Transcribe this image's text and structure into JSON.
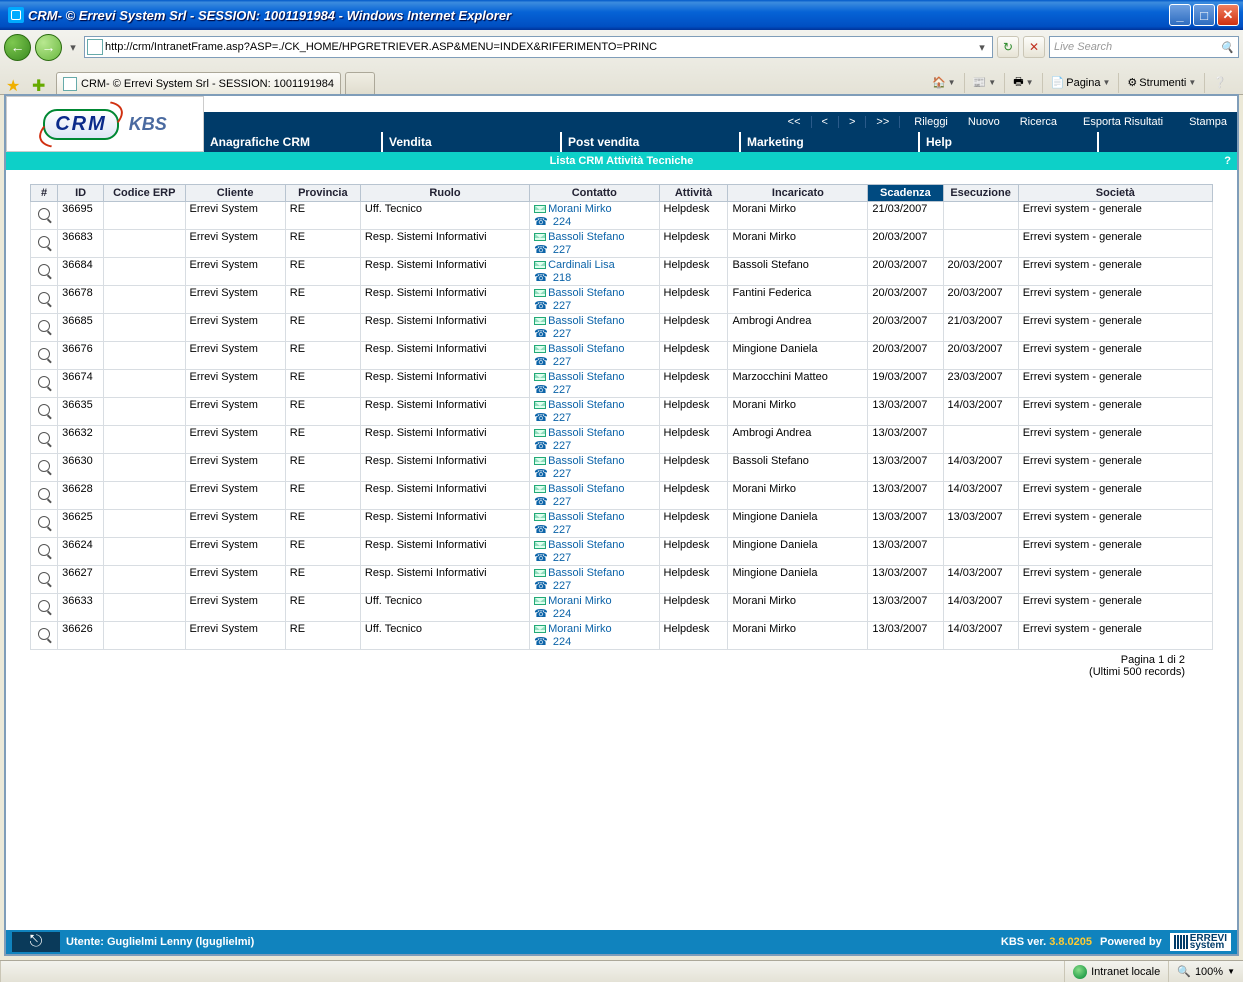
{
  "window": {
    "title": "CRM- © Errevi System Srl - SESSION: 1001191984 - Windows Internet Explorer"
  },
  "browser": {
    "url": "http://crm/IntranetFrame.asp?ASP=./CK_HOME/HPGRETRIEVER.ASP&MENU=INDEX&RIFERIMENTO=PRINC",
    "search_placeholder": "Live Search",
    "tab_title": "CRM- © Errevi System Srl - SESSION: 1001191984",
    "page_menu": "Pagina",
    "tools_menu": "Strumenti"
  },
  "crm": {
    "logo": "CRM",
    "kbs": "KBS",
    "nav": {
      "first": "<<",
      "prev": "<",
      "next": ">",
      "last": ">>"
    },
    "actions": {
      "rileggi": "Rileggi",
      "nuovo": "Nuovo",
      "ricerca": "Ricerca",
      "esporta": "Esporta Risultati",
      "stampa": "Stampa"
    },
    "menu": {
      "anagrafiche": "Anagrafiche CRM",
      "vendita": "Vendita",
      "postvendita": "Post vendita",
      "marketing": "Marketing",
      "help": "Help"
    },
    "list_title": "Lista CRM Attività Tecniche",
    "help_q": "?"
  },
  "table": {
    "headers": {
      "num": "#",
      "id": "ID",
      "erp": "Codice ERP",
      "cliente": "Cliente",
      "provincia": "Provincia",
      "ruolo": "Ruolo",
      "contatto": "Contatto",
      "attivita": "Attività",
      "incaricato": "Incaricato",
      "scadenza": "Scadenza",
      "esecuzione": "Esecuzione",
      "societa": "Società"
    },
    "rows": [
      {
        "id": "36695",
        "cliente": "Errevi System",
        "prov": "RE",
        "ruolo": "Uff. Tecnico",
        "contatto": "Morani Mirko",
        "ext": "224",
        "att": "Helpdesk",
        "inc": "Morani Mirko",
        "sca": "21/03/2007",
        "ese": "",
        "soc": "Errevi system - generale"
      },
      {
        "id": "36683",
        "cliente": "Errevi System",
        "prov": "RE",
        "ruolo": "Resp. Sistemi Informativi",
        "contatto": "Bassoli Stefano",
        "ext": "227",
        "att": "Helpdesk",
        "inc": "Morani Mirko",
        "sca": "20/03/2007",
        "ese": "",
        "soc": "Errevi system - generale"
      },
      {
        "id": "36684",
        "cliente": "Errevi System",
        "prov": "RE",
        "ruolo": "Resp. Sistemi Informativi",
        "contatto": "Cardinali Lisa",
        "ext": "218",
        "att": "Helpdesk",
        "inc": "Bassoli Stefano",
        "sca": "20/03/2007",
        "ese": "20/03/2007",
        "soc": "Errevi system - generale"
      },
      {
        "id": "36678",
        "cliente": "Errevi System",
        "prov": "RE",
        "ruolo": "Resp. Sistemi Informativi",
        "contatto": "Bassoli Stefano",
        "ext": "227",
        "att": "Helpdesk",
        "inc": "Fantini Federica",
        "sca": "20/03/2007",
        "ese": "20/03/2007",
        "soc": "Errevi system - generale"
      },
      {
        "id": "36685",
        "cliente": "Errevi System",
        "prov": "RE",
        "ruolo": "Resp. Sistemi Informativi",
        "contatto": "Bassoli Stefano",
        "ext": "227",
        "att": "Helpdesk",
        "inc": "Ambrogi Andrea",
        "sca": "20/03/2007",
        "ese": "21/03/2007",
        "soc": "Errevi system - generale"
      },
      {
        "id": "36676",
        "cliente": "Errevi System",
        "prov": "RE",
        "ruolo": "Resp. Sistemi Informativi",
        "contatto": "Bassoli Stefano",
        "ext": "227",
        "att": "Helpdesk",
        "inc": "Mingione Daniela",
        "sca": "20/03/2007",
        "ese": "20/03/2007",
        "soc": "Errevi system - generale"
      },
      {
        "id": "36674",
        "cliente": "Errevi System",
        "prov": "RE",
        "ruolo": "Resp. Sistemi Informativi",
        "contatto": "Bassoli Stefano",
        "ext": "227",
        "att": "Helpdesk",
        "inc": "Marzocchini Matteo",
        "sca": "19/03/2007",
        "ese": "23/03/2007",
        "soc": "Errevi system - generale"
      },
      {
        "id": "36635",
        "cliente": "Errevi System",
        "prov": "RE",
        "ruolo": "Resp. Sistemi Informativi",
        "contatto": "Bassoli Stefano",
        "ext": "227",
        "att": "Helpdesk",
        "inc": "Morani Mirko",
        "sca": "13/03/2007",
        "ese": "14/03/2007",
        "soc": "Errevi system - generale"
      },
      {
        "id": "36632",
        "cliente": "Errevi System",
        "prov": "RE",
        "ruolo": "Resp. Sistemi Informativi",
        "contatto": "Bassoli Stefano",
        "ext": "227",
        "att": "Helpdesk",
        "inc": "Ambrogi Andrea",
        "sca": "13/03/2007",
        "ese": "",
        "soc": "Errevi system - generale"
      },
      {
        "id": "36630",
        "cliente": "Errevi System",
        "prov": "RE",
        "ruolo": "Resp. Sistemi Informativi",
        "contatto": "Bassoli Stefano",
        "ext": "227",
        "att": "Helpdesk",
        "inc": "Bassoli Stefano",
        "sca": "13/03/2007",
        "ese": "14/03/2007",
        "soc": "Errevi system - generale"
      },
      {
        "id": "36628",
        "cliente": "Errevi System",
        "prov": "RE",
        "ruolo": "Resp. Sistemi Informativi",
        "contatto": "Bassoli Stefano",
        "ext": "227",
        "att": "Helpdesk",
        "inc": "Morani Mirko",
        "sca": "13/03/2007",
        "ese": "14/03/2007",
        "soc": "Errevi system - generale"
      },
      {
        "id": "36625",
        "cliente": "Errevi System",
        "prov": "RE",
        "ruolo": "Resp. Sistemi Informativi",
        "contatto": "Bassoli Stefano",
        "ext": "227",
        "att": "Helpdesk",
        "inc": "Mingione Daniela",
        "sca": "13/03/2007",
        "ese": "13/03/2007",
        "soc": "Errevi system - generale"
      },
      {
        "id": "36624",
        "cliente": "Errevi System",
        "prov": "RE",
        "ruolo": "Resp. Sistemi Informativi",
        "contatto": "Bassoli Stefano",
        "ext": "227",
        "att": "Helpdesk",
        "inc": "Mingione Daniela",
        "sca": "13/03/2007",
        "ese": "",
        "soc": "Errevi system - generale"
      },
      {
        "id": "36627",
        "cliente": "Errevi System",
        "prov": "RE",
        "ruolo": "Resp. Sistemi Informativi",
        "contatto": "Bassoli Stefano",
        "ext": "227",
        "att": "Helpdesk",
        "inc": "Mingione Daniela",
        "sca": "13/03/2007",
        "ese": "14/03/2007",
        "soc": "Errevi system - generale"
      },
      {
        "id": "36633",
        "cliente": "Errevi System",
        "prov": "RE",
        "ruolo": "Uff. Tecnico",
        "contatto": "Morani Mirko",
        "ext": "224",
        "att": "Helpdesk",
        "inc": "Morani Mirko",
        "sca": "13/03/2007",
        "ese": "14/03/2007",
        "soc": "Errevi system - generale"
      },
      {
        "id": "36626",
        "cliente": "Errevi System",
        "prov": "RE",
        "ruolo": "Uff. Tecnico",
        "contatto": "Morani Mirko",
        "ext": "224",
        "att": "Helpdesk",
        "inc": "Morani Mirko",
        "sca": "13/03/2007",
        "ese": "14/03/2007",
        "soc": "Errevi system - generale"
      }
    ],
    "pager_line1": "Pagina 1 di 2",
    "pager_line2": "(Ultimi 500 records)"
  },
  "footer": {
    "user_label": "Utente: Guglielmi Lenny (lguglielmi)",
    "kbs_label": "KBS ver.",
    "version": "3.8.0205",
    "powered": "Powered by",
    "errevi": "ERREVI",
    "system": "system"
  },
  "iestatus": {
    "zone": "Intranet locale",
    "zoom": "100%"
  }
}
